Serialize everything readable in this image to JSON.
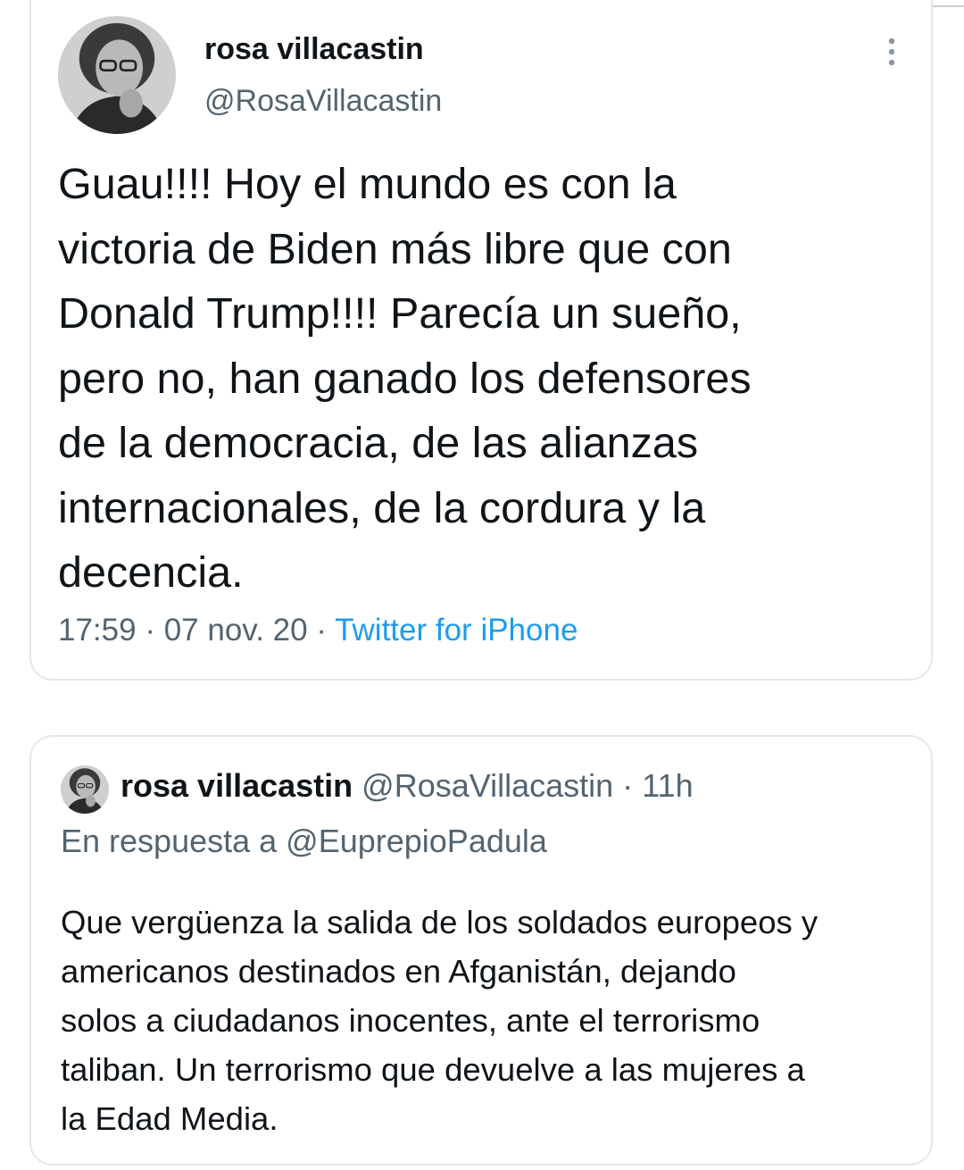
{
  "tweet": {
    "display_name": "rosa villacastin",
    "handle": "@RosaVillacastin",
    "text": "Guau!!!! Hoy el mundo es con la\nvictoria de Biden más libre que con\nDonald Trump!!!! Parecía un sueño,\npero no, han ganado los defensores\nde la democracia, de las alianzas\ninternacionales, de la cordura y la\ndecencia.",
    "time": "17:59",
    "date": "07 nov. 20",
    "separator": "·",
    "source": "Twitter for iPhone",
    "more_icon": "more-vertical-icon"
  },
  "quoted_tweet": {
    "display_name": "rosa villacastin",
    "handle": "@RosaVillacastin",
    "separator": "·",
    "age": "11h",
    "reply_to": "En respuesta a @EuprepioPadula",
    "text": "Que vergüenza la salida de los soldados europeos y\namericanos destinados en Afganistán, dejando\nsolos a ciudadanos inocentes, ante el terrorismo\ntaliban. Un terrorismo que devuelve a las mujeres a\nla Edad Media."
  },
  "colors": {
    "text": "#0f1419",
    "secondary": "#536471",
    "link": "#1d9bf0",
    "border": "#e3e8ec"
  }
}
